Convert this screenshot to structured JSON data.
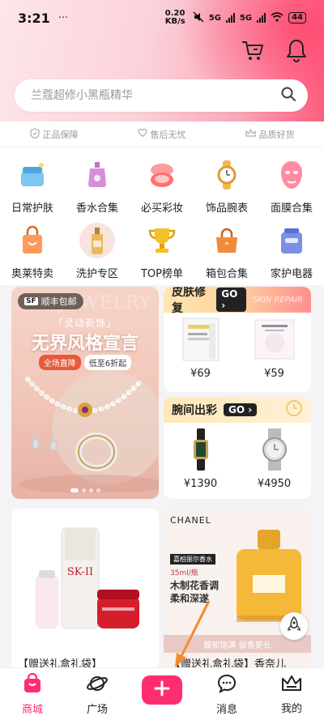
{
  "status_bar": {
    "time": "3:21",
    "extra": "··· ",
    "network_speed": "0.20 KB/s",
    "net1": "5G",
    "net2": "5G",
    "battery": "44"
  },
  "search": {
    "placeholder": "兰蔻超修小黑瓶精华"
  },
  "guarantees": [
    "正品保障",
    "售后无忧",
    "品质好货"
  ],
  "categories": [
    {
      "label": "日常护肤",
      "icon": "skincare-jar-icon",
      "color": "#8fd3f5"
    },
    {
      "label": "香水合集",
      "icon": "perfume-bottle-icon",
      "color": "#d88fd6"
    },
    {
      "label": "必买彩妆",
      "icon": "makeup-compact-icon",
      "color": "#ff8c8c"
    },
    {
      "label": "饰品腕表",
      "icon": "watch-icon",
      "color": "#f5c36a"
    },
    {
      "label": "面膜合集",
      "icon": "face-mask-icon",
      "color": "#ff8fa6"
    },
    {
      "label": "奥莱特卖",
      "icon": "shopping-bag-icon",
      "color": "#ff9a5a"
    },
    {
      "label": "洗护专区",
      "icon": "shampoo-bottle-icon",
      "color": "#e0b060"
    },
    {
      "label": "TOP榜单",
      "icon": "trophy-icon",
      "color": "#f5c02a"
    },
    {
      "label": "箱包合集",
      "icon": "handbag-icon",
      "color": "#f28a3a"
    },
    {
      "label": "家护电器",
      "icon": "appliance-icon",
      "color": "#7a8fe8"
    }
  ],
  "jewelry_banner": {
    "badge": "顺丰包邮",
    "watermark": "JEWELRY",
    "subtitle": "「灵动新饰」",
    "title": "无界风格宣言",
    "tag1": "全场直降",
    "tag2": "低至6折起"
  },
  "skin_repair": {
    "title": "皮肤修复",
    "go": "GO",
    "watermark": "SKIN REPAIR",
    "products": [
      {
        "price": "¥69"
      },
      {
        "price": "¥59"
      }
    ]
  },
  "wrist": {
    "title": "腕间出彩",
    "go": "GO",
    "products": [
      {
        "price": "¥1390"
      },
      {
        "price": "¥4950"
      }
    ]
  },
  "feed": [
    {
      "brand": "SK-II",
      "caption": "【赠送礼盒礼袋】"
    },
    {
      "brand": "CHANEL",
      "tag": "嘉柏丽尔香水",
      "size": "35ml/瓶",
      "line1": "木制花香调",
      "line2": "柔和深遂",
      "footer": "馥郁饱满 留香更长",
      "caption": "【赠送礼盒礼袋】香奈儿"
    }
  ],
  "tabbar": {
    "items": [
      "商城",
      "广场",
      "消息",
      "我的"
    ]
  },
  "colors": {
    "accent": "#ff2d6f"
  }
}
